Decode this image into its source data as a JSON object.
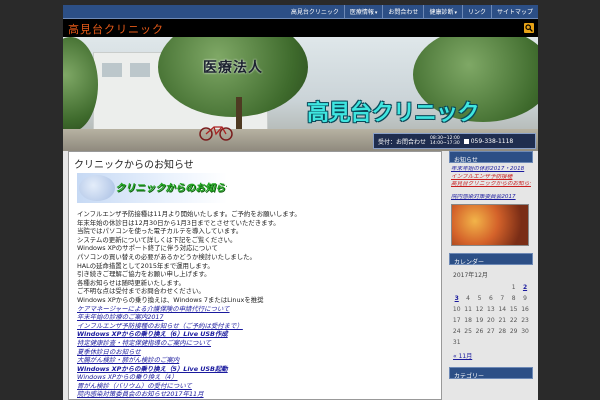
{
  "nav": {
    "items": [
      {
        "label": "高見台クリニック",
        "dropdown": false
      },
      {
        "label": "医療情報",
        "dropdown": true
      },
      {
        "label": "お問合わせ",
        "dropdown": false
      },
      {
        "label": "健康診断",
        "dropdown": true
      },
      {
        "label": "リンク",
        "dropdown": false
      },
      {
        "label": "サイトマップ",
        "dropdown": false
      }
    ]
  },
  "header": {
    "title": "高見台クリニック"
  },
  "banner": {
    "corp": "医療法人",
    "name": "高見台クリニック",
    "contact_label": "受付：お問合わせ",
    "hours_am": "08:30~12:00",
    "hours_pm": "14:00~17:30",
    "phone": "059-338-1118"
  },
  "post": {
    "title": "クリニックからのお知らせ",
    "image_text": "クリニックからのお知らせ",
    "lines": [
      {
        "text": "インフルエンザ予防接種は11月より開始いたします。ご予約をお願いします。",
        "style": ""
      },
      {
        "text": "年末年始の休診日は12月30日から1月3日までとさせていただきます。",
        "style": ""
      },
      {
        "text": "当院ではパソコンを使った電子カルテを導入しています。",
        "style": ""
      },
      {
        "text": "システムの更新について詳しくは下記をご覧ください。",
        "style": ""
      },
      {
        "text": "Windows XPのサポート終了に伴う対応について",
        "style": ""
      },
      {
        "text": "パソコンの買い替えの必要があるかどうか検討いたしました。",
        "style": ""
      },
      {
        "text": "HALの延命措置として2015年まで運用します。",
        "style": ""
      },
      {
        "text": "引き続きご理解ご協力をお願い申し上げます。",
        "style": ""
      },
      {
        "text": "各種お知らせは随時更新いたします。",
        "style": ""
      },
      {
        "text": "ご不明な点は受付までお問合わせください。",
        "style": ""
      },
      {
        "text": "Windows XPからの乗り換えは、Windows 7またはLinuxを推奨",
        "style": ""
      },
      {
        "text": "ケアマネージャーによる介護保険の申請代行について",
        "style": "link"
      },
      {
        "text": "年末年始の診療のご案内2017",
        "style": "link"
      },
      {
        "text": "インフルエンザ予防接種のお知らせ（ご予約は受付まで）",
        "style": "link"
      },
      {
        "text": "Windows XPからの乗り換え（6）Live USB作成",
        "style": "link bold"
      },
      {
        "text": "特定健康診査・特定保健指導のご案内について",
        "style": "link"
      },
      {
        "text": "夏季休診日のお知らせ",
        "style": "link"
      },
      {
        "text": "大腸がん検診・肺がん検診のご案内",
        "style": "link"
      },
      {
        "text": "Windows XPからの乗り換え（5）Live USB起動",
        "style": "link bold"
      },
      {
        "text": "Windows XPからの乗り換え（4）",
        "style": "link"
      },
      {
        "text": "胃がん検診（バリウム）の受付について",
        "style": "link"
      },
      {
        "text": "院内感染対策委員会のお知らせ2017年11月",
        "style": "link"
      }
    ]
  },
  "sidebar": {
    "news_head": "お知らせ",
    "news_links": [
      {
        "text": "年末年始の休診2017・2018",
        "style": ""
      },
      {
        "text": "インフルエンザ予防接種",
        "style": "red"
      },
      {
        "text": "高見台クリニックからのお知らせ20171121",
        "style": "red"
      },
      {
        "text": "",
        "style": ""
      },
      {
        "text": "院内感染対策委員会2017",
        "style": ""
      }
    ],
    "calendar_head": "カレンダー",
    "calendar_caption": "2017年12月",
    "calendar_weeks": [
      [
        "",
        "",
        "",
        "",
        "",
        "1",
        "2"
      ],
      [
        "3",
        "4",
        "5",
        "6",
        "7",
        "8",
        "9"
      ],
      [
        "10",
        "11",
        "12",
        "13",
        "14",
        "15",
        "16"
      ],
      [
        "17",
        "18",
        "19",
        "20",
        "21",
        "22",
        "23"
      ],
      [
        "24",
        "25",
        "26",
        "27",
        "28",
        "29",
        "30"
      ],
      [
        "31",
        "",
        "",
        "",
        "",
        "",
        ""
      ]
    ],
    "calendar_links": [
      "2",
      "3"
    ],
    "calendar_prev": "« 11月",
    "bottom_head": "カテゴリー"
  },
  "colors": {
    "nav_bg": "#2c4f86",
    "title_orange": "#e65a18",
    "banner_cyan": "#3fe6e0",
    "link_blue": "#1a1a9e",
    "link_red": "#c81e1e",
    "notice_green": "#1ea51e"
  },
  "icons": {
    "search": "search-icon",
    "phone": "phone-icon",
    "caret": "chevron-down-icon"
  }
}
